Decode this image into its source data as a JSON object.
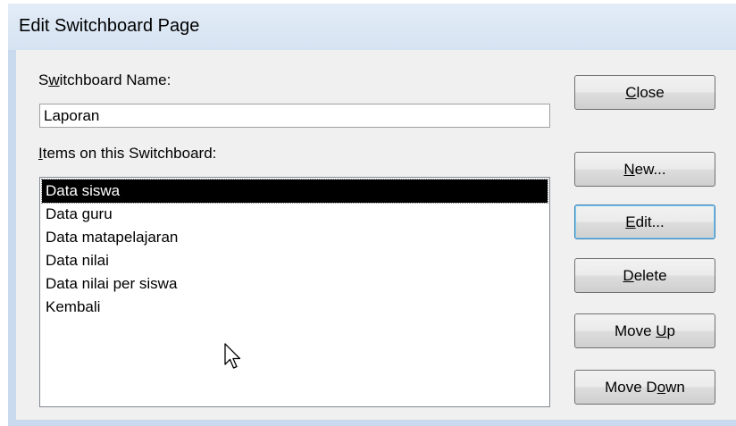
{
  "window": {
    "title": "Edit Switchboard Page"
  },
  "form": {
    "name_label_pre": "S",
    "name_label_u": "w",
    "name_label_post": "itchboard Name:",
    "name_value": "Laporan",
    "items_label_u": "I",
    "items_label_post": "tems on this Switchboard:"
  },
  "list": {
    "items": [
      {
        "label": "Data siswa",
        "selected": true
      },
      {
        "label": "Data guru",
        "selected": false
      },
      {
        "label": "Data matapelajaran",
        "selected": false
      },
      {
        "label": "Data nilai",
        "selected": false
      },
      {
        "label": "Data nilai per siswa",
        "selected": false
      },
      {
        "label": "Kembali",
        "selected": false
      }
    ]
  },
  "buttons": {
    "close": {
      "u": "C",
      "rest": "lose"
    },
    "new": {
      "u": "N",
      "rest": "ew..."
    },
    "edit": {
      "u": "E",
      "rest": "dit..."
    },
    "delete": {
      "u": "D",
      "rest": "elete"
    },
    "move_up": {
      "pre": "Move ",
      "u": "U",
      "rest": "p"
    },
    "move_down": {
      "pre": "Move D",
      "u": "o",
      "rest": "wn"
    }
  },
  "colors": {
    "title_bar": "#d6e3f2",
    "dialog_bg": "#f0f0f0",
    "selection_bg": "#000000",
    "focus_border": "#3c7fb1"
  }
}
